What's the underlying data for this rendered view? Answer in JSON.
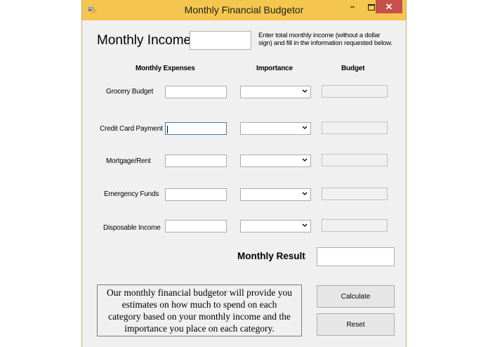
{
  "window": {
    "title": "Monthly Financial Budgetor",
    "controls": {
      "minimize": "–",
      "close": "✕"
    }
  },
  "income": {
    "label": "Monthly Income",
    "value": "",
    "hint_line1": "Enter total monthly income (without a dollar",
    "hint_line2": "sign) and fill in the information requested below."
  },
  "headers": {
    "expenses": "Monthly Expenses",
    "importance": "Importance",
    "budget": "Budget"
  },
  "rows": [
    {
      "label": "Grocery Budget",
      "value": "",
      "importance": "",
      "budget": ""
    },
    {
      "label": "Credit Card Payment",
      "value": "",
      "importance": "",
      "budget": ""
    },
    {
      "label": "Mortgage/Rent",
      "value": "",
      "importance": "",
      "budget": ""
    },
    {
      "label": "Emergency Funds",
      "value": "",
      "importance": "",
      "budget": ""
    },
    {
      "label": "Disposable Income",
      "value": "",
      "importance": "",
      "budget": ""
    }
  ],
  "result": {
    "label": "Monthly Result",
    "value": ""
  },
  "description": [
    "Our monthly financial budgetor will provide you",
    "estimates on how much to spend on each",
    "category based on your monthly income and the",
    "importance you place on each category."
  ],
  "buttons": {
    "calculate": "Calculate",
    "reset": "Reset"
  },
  "colors": {
    "titlebar": "#f4c64e",
    "close": "#c74f4e",
    "focus": "#3c7fb1",
    "face": "#f0f0f0"
  }
}
